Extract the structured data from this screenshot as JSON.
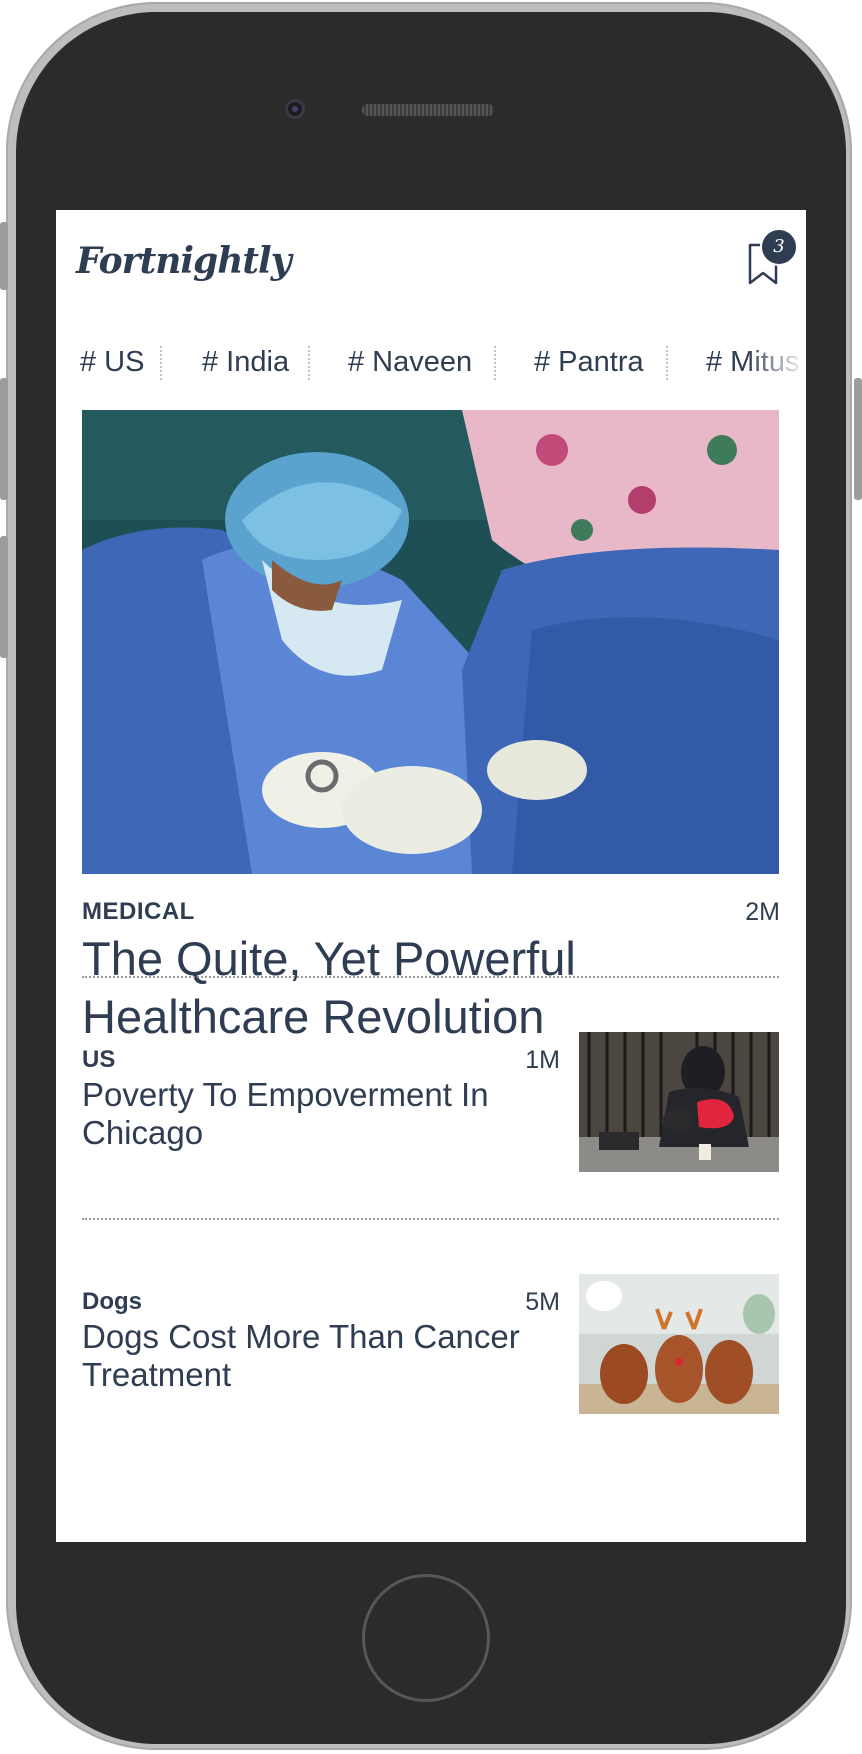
{
  "header": {
    "logo": "Fortnightly",
    "bookmark_count": "3"
  },
  "tags": [
    "# US",
    "# India",
    "# Naveen",
    "# Pantra",
    "# Mitus"
  ],
  "hero": {
    "category": "MEDICAL",
    "time": "2M",
    "title": "The Quite, Yet Powerful Healthcare Revolution"
  },
  "articles": [
    {
      "category": "US",
      "time": "1M",
      "title": "Poverty To Empoverment In Chicago"
    },
    {
      "category": "Dogs",
      "time": "5M",
      "title": "Dogs Cost More Than Cancer Treatment"
    }
  ]
}
